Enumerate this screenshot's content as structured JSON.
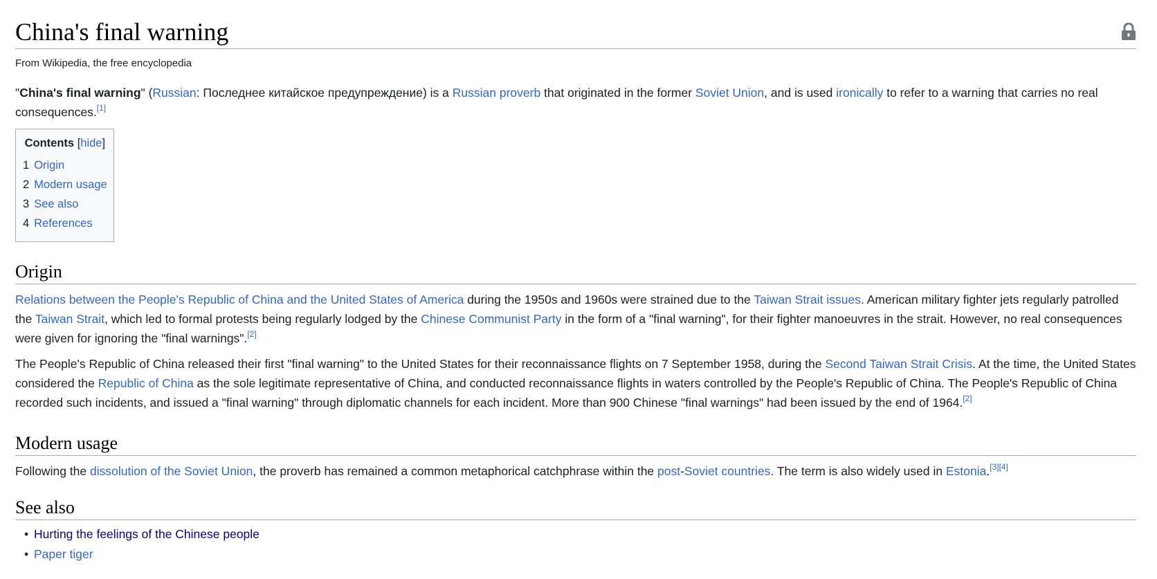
{
  "article": {
    "title": "China's final warning",
    "tagline": "From Wikipedia, the free encyclopedia"
  },
  "lead": {
    "q1": "\"",
    "bold": "China's final warning",
    "q2": "\" (",
    "l_russian": "Russian",
    "t1": ": Последнее китайское предупреждение) is a ",
    "l_russian_proverb": "Russian proverb",
    "t2": " that originated in the former ",
    "l_soviet_union": "Soviet Union",
    "t3": ", and is used ",
    "l_ironically": "ironically",
    "t4": " to refer to a warning that carries no real consequences.",
    "ref1": "[1]"
  },
  "toc": {
    "title": "Contents",
    "hide_open": "[",
    "hide": "hide",
    "hide_close": "]",
    "items": [
      {
        "num": "1",
        "label": "Origin"
      },
      {
        "num": "2",
        "label": "Modern usage"
      },
      {
        "num": "3",
        "label": "See also"
      },
      {
        "num": "4",
        "label": "References"
      }
    ]
  },
  "origin": {
    "heading": "Origin",
    "p1": {
      "l_relations": "Relations between the People's Republic of China and the United States of America",
      "t1": " during the 1950s and 1960s were strained due to the ",
      "l_taiwan_issues": "Taiwan Strait issues",
      "t2": ". American military fighter jets regularly patrolled the ",
      "l_taiwan_strait": "Taiwan Strait",
      "t3": ", which led to formal protests being regularly lodged by the ",
      "l_ccp": "Chinese Communist Party",
      "t4": " in the form of a \"final warning\", for their fighter manoeuvres in the strait. However, no real consequences were given for ignoring the \"final warnings\".",
      "ref2": "[2]"
    },
    "p2": {
      "t1": "The People's Republic of China released their first \"final warning\" to the United States for their reconnaissance flights on 7 September 1958, during the ",
      "l_second_crisis": "Second Taiwan Strait Crisis",
      "t2": ". At the time, the United States considered the ",
      "l_roc": "Republic of China",
      "t3": " as the sole legitimate representative of China, and conducted reconnaissance flights in waters controlled by the People's Republic of China. The People's Republic of China recorded such incidents, and issued a \"final warning\" through diplomatic channels for each incident. More than 900 Chinese \"final warnings\" had been issued by the end of 1964.",
      "ref2": "[2]"
    }
  },
  "modern": {
    "heading": "Modern usage",
    "t1": "Following the ",
    "l_dissolution": "dissolution of the Soviet Union",
    "t2": ", the proverb has remained a common metaphorical catchphrase within the ",
    "l_post": "post",
    "dash": "-",
    "l_soviet_countries": "Soviet countries",
    "t3": ". The term is also widely used in ",
    "l_estonia": "Estonia",
    "t4": ".",
    "ref3": "[3]",
    "ref4": "[4]"
  },
  "see_also": {
    "heading": "See also",
    "items": [
      "Hurting the feelings of the Chinese people",
      "Paper tiger"
    ]
  },
  "icons": {
    "lock": "lock-icon"
  },
  "colors": {
    "link": "#3366cc",
    "visited_link": "#0b0080",
    "text": "#202122",
    "rule": "#a2a9b1"
  }
}
